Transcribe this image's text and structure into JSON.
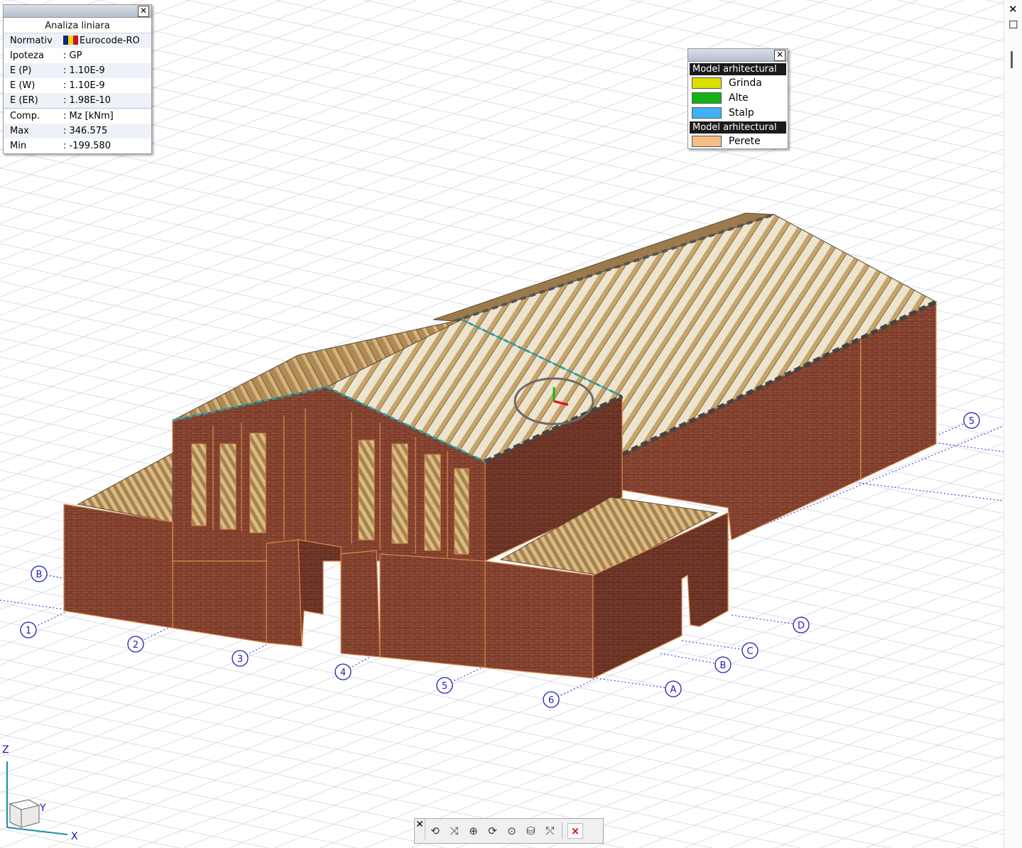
{
  "analysis_panel": {
    "heading": "Analiza liniara",
    "rows": [
      {
        "key": "Normativ",
        "value": "Eurocode-RO",
        "flag": true
      },
      {
        "key": "Ipoteza",
        "value": ": GP"
      },
      {
        "key": "E (P)",
        "value": ": 1.10E-9"
      },
      {
        "key": "E (W)",
        "value": ": 1.10E-9"
      },
      {
        "key": "E (ER)",
        "value": ": 1.98E-10"
      },
      {
        "key": "Comp.",
        "value": ": Mz [kNm]"
      },
      {
        "key": "Max",
        "value": ": 346.575"
      },
      {
        "key": "Min",
        "value": ": -199.580"
      }
    ],
    "flag_colors": [
      "#002b7f",
      "#fcd116",
      "#ce1126"
    ]
  },
  "legend_panel": {
    "groups": [
      {
        "header": "Model arhitectural",
        "items": [
          {
            "label": "Grinda",
            "color": "#dede00"
          },
          {
            "label": "Alte",
            "color": "#12b312"
          },
          {
            "label": "Stalp",
            "color": "#3fb2f5"
          }
        ]
      },
      {
        "header": "Model arhitectural",
        "items": [
          {
            "label": "Perete",
            "color": "#f5be82"
          }
        ]
      }
    ]
  },
  "grid_bubbles": {
    "numbers": [
      "1",
      "2",
      "3",
      "4",
      "5",
      "6",
      "5"
    ],
    "letters": [
      "B",
      "A",
      "B",
      "C",
      "D"
    ]
  },
  "axes": {
    "z": "Z",
    "y": "Y",
    "x": "X"
  },
  "window_controls": {
    "close": "✕",
    "restore": "☐"
  },
  "toolbar": {
    "close": "✕",
    "buttons": [
      {
        "name": "rotate-orbit-icon",
        "glyph": "⟲"
      },
      {
        "name": "rotate-x-icon",
        "glyph": "⤨"
      },
      {
        "name": "rotate-y-icon",
        "glyph": "⊕"
      },
      {
        "name": "rotate-z-icon",
        "glyph": "⟳"
      },
      {
        "name": "rotate-point-icon",
        "glyph": "⊙"
      },
      {
        "name": "view-layers-icon",
        "glyph": "⛁"
      },
      {
        "name": "reset-axes-icon",
        "glyph": "⤲"
      }
    ],
    "cancel": "×"
  },
  "colors": {
    "brick": "#8a4632",
    "brick_dark": "#6b3424",
    "brick_outline": "#d98a4a",
    "timber": "#c8a570",
    "timber_light": "#e6d7b8",
    "grid_line": "#1a1aa6"
  }
}
